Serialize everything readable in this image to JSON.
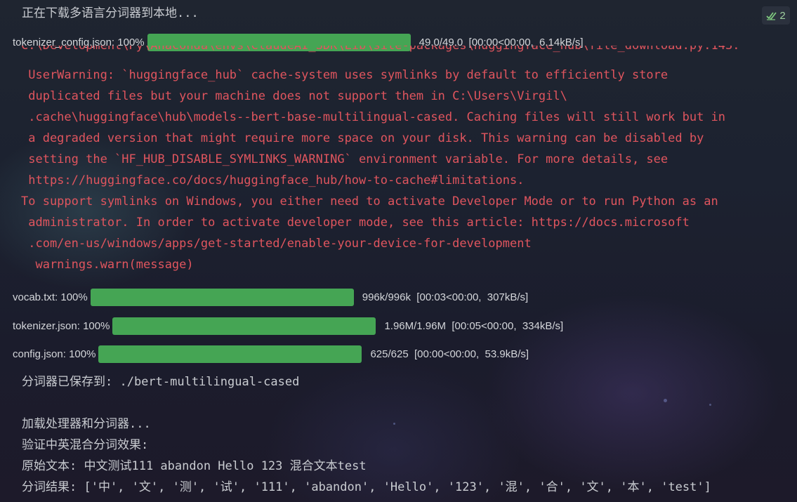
{
  "status_badge": {
    "count": "2"
  },
  "header_line": "正在下载多语言分词器到本地...",
  "progress_bars": [
    {
      "name": "tokenizer_config.json:",
      "percent_label": "100%",
      "progress": 100,
      "stats": "49.0/49.0  [00:00<00:00,  6.14kB/s]"
    },
    {
      "name": "vocab.txt:",
      "percent_label": "100%",
      "progress": 100,
      "stats": "996k/996k  [00:03<00:00,  307kB/s]"
    },
    {
      "name": "tokenizer.json:",
      "percent_label": "100%",
      "progress": 100,
      "stats": "1.96M/1.96M  [00:05<00:00,  334kB/s]"
    },
    {
      "name": "config.json:",
      "percent_label": "100%",
      "progress": 100,
      "stats": "625/625  [00:00<00:00,  53.9kB/s]"
    }
  ],
  "warning": {
    "cut_line": "C:\\Development\\Py\\Anaconda\\envs\\ClaudeAI_SDK\\Lib\\site-packages\\huggingface_hub\\file_download.py:143:",
    "lines": [
      " UserWarning: `huggingface_hub` cache-system uses symlinks by default to efficiently store",
      " duplicated files but your machine does not support them in C:\\Users\\Virgil\\",
      " .cache\\huggingface\\hub\\models--bert-base-multilingual-cased. Caching files will still work but in",
      " a degraded version that might require more space on your disk. This warning can be disabled by",
      " setting the `HF_HUB_DISABLE_SYMLINKS_WARNING` environment variable. For more details, see",
      " https://huggingface.co/docs/huggingface_hub/how-to-cache#limitations.",
      "To support symlinks on Windows, you either need to activate Developer Mode or to run Python as an",
      " administrator. In order to activate developer mode, see this article: https://docs.microsoft",
      " .com/en-us/windows/apps/get-started/enable-your-device-for-development",
      "  warnings.warn(message)"
    ]
  },
  "output_lines": [
    "分词器已保存到: ./bert-multilingual-cased",
    "",
    "加载处理器和分词器...",
    "验证中英混合分词效果:",
    "原始文本: 中文测试111 abandon Hello 123 混合文本test",
    "分词结果: ['中', '文', '测', '试', '111', 'abandon', 'Hello', '123', '混', '合', '文', '本', 'test']"
  ]
}
